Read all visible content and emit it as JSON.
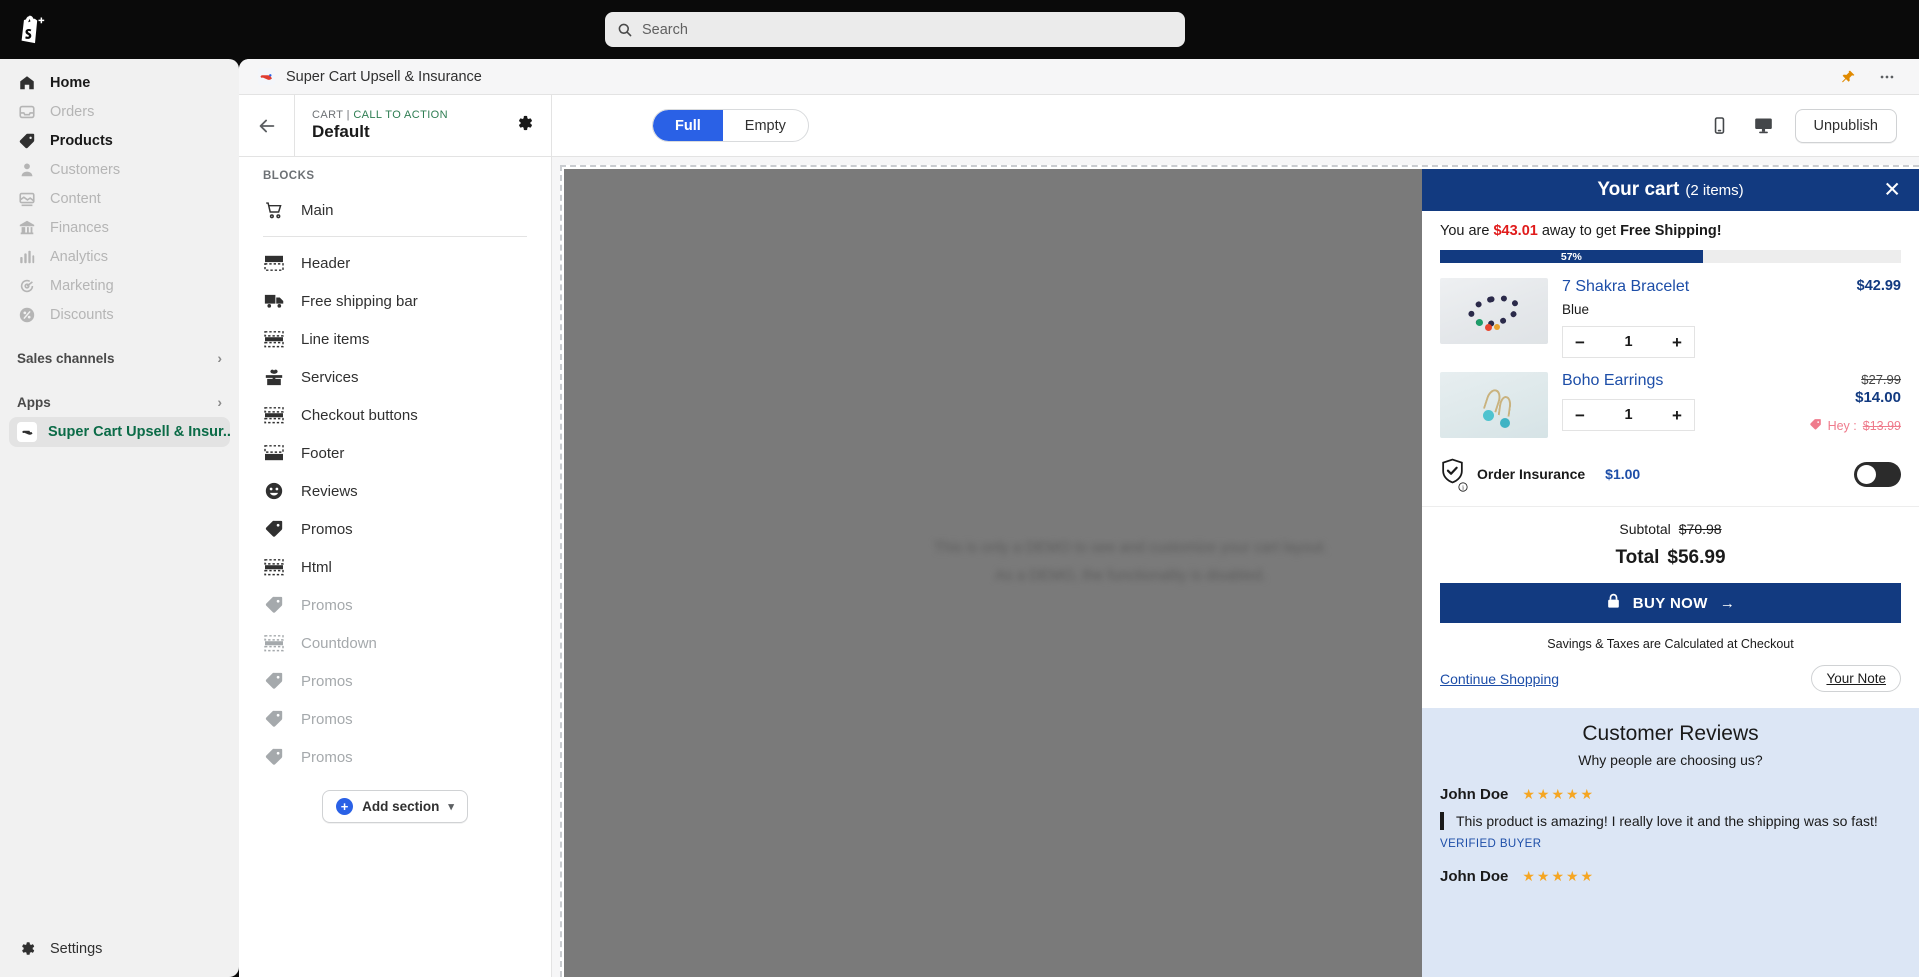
{
  "topbar": {
    "logo_icon": "shopify-bag-plus-icon",
    "search": {
      "icon": "search-icon",
      "placeholder": "Search",
      "value": ""
    }
  },
  "sidebar": {
    "items": [
      {
        "label": "Home",
        "icon": "home-icon",
        "active": true
      },
      {
        "label": "Orders",
        "icon": "orders-inbox-icon",
        "active": false
      },
      {
        "label": "Products",
        "icon": "product-tag-icon",
        "active": true
      },
      {
        "label": "Customers",
        "icon": "customer-person-icon",
        "active": false
      },
      {
        "label": "Content",
        "icon": "content-image-icon",
        "active": false
      },
      {
        "label": "Finances",
        "icon": "finances-bank-icon",
        "active": false
      },
      {
        "label": "Analytics",
        "icon": "analytics-bars-icon",
        "active": false
      },
      {
        "label": "Marketing",
        "icon": "marketing-target-icon",
        "active": false
      },
      {
        "label": "Discounts",
        "icon": "discount-percent-icon",
        "active": false
      }
    ],
    "sections": [
      {
        "label": "Sales channels",
        "icon": "chevron-right-icon"
      },
      {
        "label": "Apps",
        "icon": "chevron-right-icon"
      }
    ],
    "app_item": {
      "label": "Super Cart Upsell & Insur...",
      "icon": "super-cart-app-icon"
    },
    "settings": {
      "label": "Settings",
      "icon": "gear-icon"
    }
  },
  "app_header": {
    "title": "Super Cart Upsell & Insurance",
    "icon": "super-cart-app-icon",
    "pin_icon": "pin-icon",
    "more_icon": "ellipsis-icon"
  },
  "toolbar": {
    "back_icon": "arrow-left-icon",
    "eyebrow_prefix": "CART | ",
    "eyebrow_cta": "CALL TO ACTION",
    "template_name": "Default",
    "settings_icon": "gear-icon",
    "segment": {
      "options": [
        "Full",
        "Empty"
      ],
      "selected": "Full"
    },
    "mobile_icon": "mobile-preview-icon",
    "desktop_icon": "desktop-preview-icon",
    "publish_label": "Unpublish"
  },
  "blocks": {
    "label": "BLOCKS",
    "main": {
      "label": "Main",
      "icon": "cart-icon"
    },
    "items": [
      {
        "label": "Header",
        "icon": "header-block-icon",
        "dim": false
      },
      {
        "label": "Free shipping bar",
        "icon": "truck-icon",
        "dim": false
      },
      {
        "label": "Line items",
        "icon": "line-items-block-icon",
        "dim": false
      },
      {
        "label": "Services",
        "icon": "gift-icon",
        "dim": false
      },
      {
        "label": "Checkout buttons",
        "icon": "checkout-block-icon",
        "dim": false
      },
      {
        "label": "Footer",
        "icon": "footer-block-icon",
        "dim": false
      },
      {
        "label": "Reviews",
        "icon": "smiley-icon",
        "dim": false
      },
      {
        "label": "Promos",
        "icon": "tag-icon",
        "dim": false
      },
      {
        "label": "Html",
        "icon": "html-block-icon",
        "dim": false
      },
      {
        "label": "Promos",
        "icon": "tag-icon",
        "dim": true
      },
      {
        "label": "Countdown",
        "icon": "countdown-block-icon",
        "dim": true
      },
      {
        "label": "Promos",
        "icon": "tag-icon",
        "dim": true
      },
      {
        "label": "Promos",
        "icon": "tag-icon",
        "dim": true
      },
      {
        "label": "Promos",
        "icon": "tag-icon",
        "dim": true
      }
    ],
    "add_section": {
      "label": "Add section",
      "icon": "plus-icon",
      "caret": "chevron-down-icon"
    }
  },
  "preview": {
    "demo_line1": "This is only a DEMO to see and customize your cart layout.",
    "demo_line2": "As a DEMO, the functionality is disabled."
  },
  "cart": {
    "title": "Your cart",
    "count_label": "(2 items)",
    "close_icon": "close-icon",
    "shipping": {
      "prefix": "You are ",
      "amount": "$43.01",
      "middle": " away to get ",
      "goal": "Free Shipping!",
      "progress_label": "57%",
      "progress_percent": 57
    },
    "line_items": [
      {
        "title": "7 Shakra Bracelet",
        "variant": "Blue",
        "qty": "1",
        "minus_icon": "minus-icon",
        "plus_icon": "plus-icon",
        "price": "$42.99",
        "old_price": "",
        "promo_label": "",
        "promo_price": "",
        "image_icon": "bracelet-thumbnail"
      },
      {
        "title": "Boho Earrings",
        "variant": "",
        "qty": "1",
        "minus_icon": "minus-icon",
        "plus_icon": "plus-icon",
        "price": "$14.00",
        "old_price": "$27.99",
        "promo_label": "Hey :",
        "promo_price": "$13.99",
        "image_icon": "earrings-thumbnail"
      }
    ],
    "insurance": {
      "icon": "shield-check-icon",
      "info_icon": "info-icon",
      "label": "Order Insurance",
      "price": "$1.00",
      "toggle_on": false
    },
    "totals": {
      "subtotal_label": "Subtotal",
      "subtotal_value": "$70.98",
      "total_label": "Total",
      "total_value": "$56.99"
    },
    "buy_button": {
      "label": "BUY NOW",
      "lock_icon": "lock-icon",
      "arrow": "→"
    },
    "savings_note": "Savings & Taxes are Calculated at Checkout",
    "continue_shopping": "Continue Shopping",
    "your_note": "Your Note",
    "reviews": {
      "title": "Customer Reviews",
      "subtitle": "Why people are choosing us?",
      "items": [
        {
          "name": "John Doe",
          "stars": "★★★★★",
          "text": "This product is amazing! I really love it and the shipping was so fast!",
          "verified": "VERIFIED BUYER"
        },
        {
          "name": "John Doe",
          "stars": "★★★★★",
          "text": "",
          "verified": ""
        }
      ]
    }
  },
  "colors": {
    "brand_navy": "#123a80",
    "accent_blue": "#2a61e6",
    "link_blue": "#1d4ea8",
    "alert_red": "#e01b1b",
    "shopify_green": "#0b6b47",
    "star_orange": "#f5a623",
    "promo_pink": "#ef7b8c",
    "reviews_bg": "#dce6f5"
  }
}
